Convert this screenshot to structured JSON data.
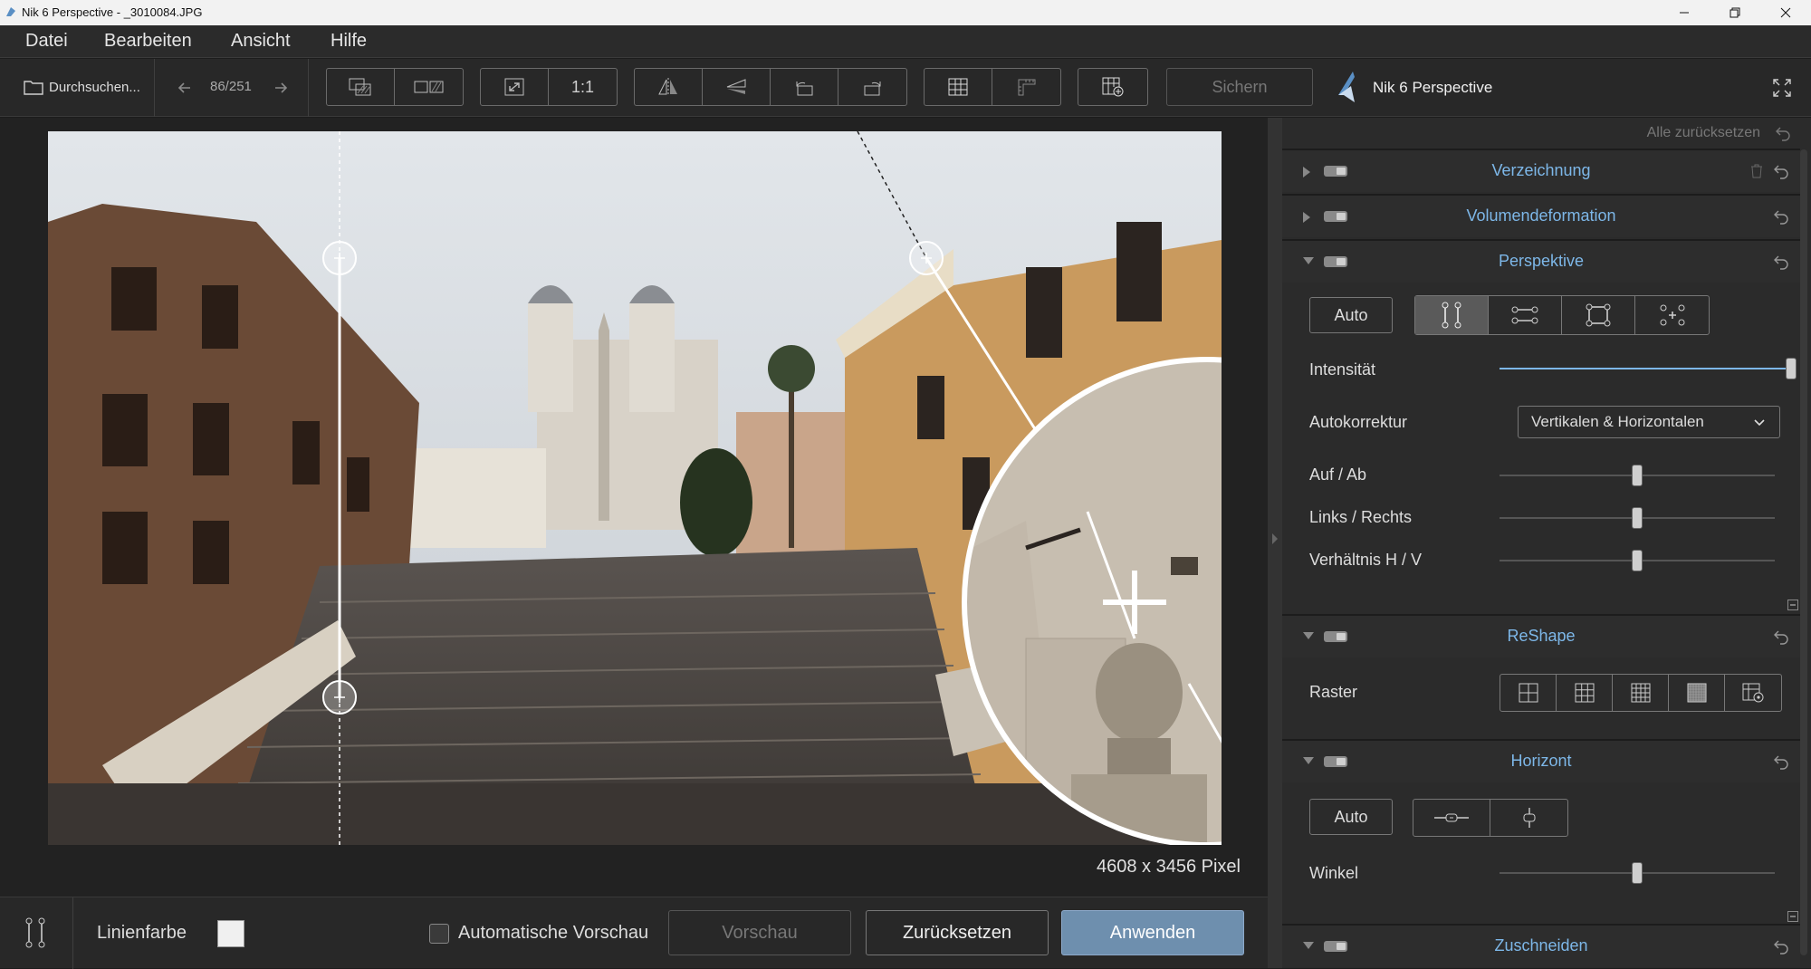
{
  "window": {
    "title": "Nik 6 Perspective - _3010084.JPG"
  },
  "menu": [
    "Datei",
    "Bearbeiten",
    "Ansicht",
    "Hilfe"
  ],
  "toolbar": {
    "browse_label": "Durchsuchen...",
    "counter": "86/251",
    "zoom_label": "1:1",
    "save_label": "Sichern",
    "brand": "Nik 6 Perspective"
  },
  "canvas": {
    "dimensions": "4608 x 3456 Pixel"
  },
  "bottom": {
    "line_color_label": "Linienfarbe",
    "auto_preview_label": "Automatische Vorschau",
    "preview_label": "Vorschau",
    "reset_label": "Zurücksetzen",
    "apply_label": "Anwenden"
  },
  "panel": {
    "reset_all": "Alle zurücksetzen",
    "sections": {
      "verzeichnung": "Verzeichnung",
      "volumen": "Volumendeformation",
      "perspektive": "Perspektive",
      "reshape": "ReShape",
      "horizont": "Horizont",
      "zuschneiden": "Zuschneiden"
    },
    "perspektive": {
      "auto_label": "Auto",
      "intensity_label": "Intensität",
      "intensity_value": 1.0,
      "autocorrect_label": "Autokorrektur",
      "autocorrect_value": "Vertikalen & Horizontalen",
      "up_down_label": "Auf / Ab",
      "up_down_value": 0.5,
      "left_right_label": "Links / Rechts",
      "left_right_value": 0.5,
      "ratio_label": "Verhältnis H / V",
      "ratio_value": 0.5
    },
    "reshape": {
      "raster_label": "Raster"
    },
    "horizont": {
      "auto_label": "Auto",
      "angle_label": "Winkel",
      "angle_value": 0.5
    }
  },
  "colors": {
    "accent": "#7db7e8",
    "apply_button": "#6e8fae",
    "line_color": "#f0f0f0"
  }
}
